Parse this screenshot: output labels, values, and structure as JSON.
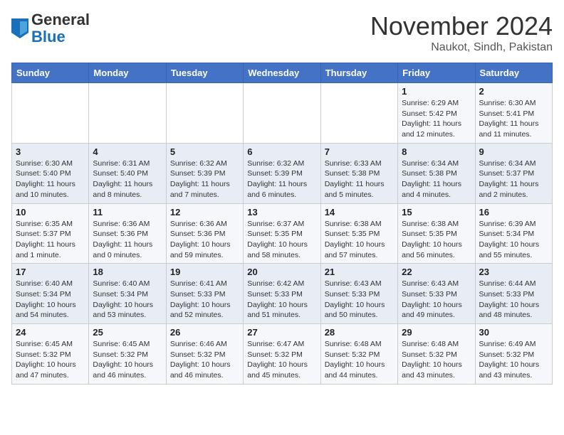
{
  "header": {
    "logo_general": "General",
    "logo_blue": "Blue",
    "month_title": "November 2024",
    "location": "Naukot, Sindh, Pakistan"
  },
  "weekdays": [
    "Sunday",
    "Monday",
    "Tuesday",
    "Wednesday",
    "Thursday",
    "Friday",
    "Saturday"
  ],
  "weeks": [
    [
      {
        "day": "",
        "info": ""
      },
      {
        "day": "",
        "info": ""
      },
      {
        "day": "",
        "info": ""
      },
      {
        "day": "",
        "info": ""
      },
      {
        "day": "",
        "info": ""
      },
      {
        "day": "1",
        "info": "Sunrise: 6:29 AM\nSunset: 5:42 PM\nDaylight: 11 hours and 12 minutes."
      },
      {
        "day": "2",
        "info": "Sunrise: 6:30 AM\nSunset: 5:41 PM\nDaylight: 11 hours and 11 minutes."
      }
    ],
    [
      {
        "day": "3",
        "info": "Sunrise: 6:30 AM\nSunset: 5:40 PM\nDaylight: 11 hours and 10 minutes."
      },
      {
        "day": "4",
        "info": "Sunrise: 6:31 AM\nSunset: 5:40 PM\nDaylight: 11 hours and 8 minutes."
      },
      {
        "day": "5",
        "info": "Sunrise: 6:32 AM\nSunset: 5:39 PM\nDaylight: 11 hours and 7 minutes."
      },
      {
        "day": "6",
        "info": "Sunrise: 6:32 AM\nSunset: 5:39 PM\nDaylight: 11 hours and 6 minutes."
      },
      {
        "day": "7",
        "info": "Sunrise: 6:33 AM\nSunset: 5:38 PM\nDaylight: 11 hours and 5 minutes."
      },
      {
        "day": "8",
        "info": "Sunrise: 6:34 AM\nSunset: 5:38 PM\nDaylight: 11 hours and 4 minutes."
      },
      {
        "day": "9",
        "info": "Sunrise: 6:34 AM\nSunset: 5:37 PM\nDaylight: 11 hours and 2 minutes."
      }
    ],
    [
      {
        "day": "10",
        "info": "Sunrise: 6:35 AM\nSunset: 5:37 PM\nDaylight: 11 hours and 1 minute."
      },
      {
        "day": "11",
        "info": "Sunrise: 6:36 AM\nSunset: 5:36 PM\nDaylight: 11 hours and 0 minutes."
      },
      {
        "day": "12",
        "info": "Sunrise: 6:36 AM\nSunset: 5:36 PM\nDaylight: 10 hours and 59 minutes."
      },
      {
        "day": "13",
        "info": "Sunrise: 6:37 AM\nSunset: 5:35 PM\nDaylight: 10 hours and 58 minutes."
      },
      {
        "day": "14",
        "info": "Sunrise: 6:38 AM\nSunset: 5:35 PM\nDaylight: 10 hours and 57 minutes."
      },
      {
        "day": "15",
        "info": "Sunrise: 6:38 AM\nSunset: 5:35 PM\nDaylight: 10 hours and 56 minutes."
      },
      {
        "day": "16",
        "info": "Sunrise: 6:39 AM\nSunset: 5:34 PM\nDaylight: 10 hours and 55 minutes."
      }
    ],
    [
      {
        "day": "17",
        "info": "Sunrise: 6:40 AM\nSunset: 5:34 PM\nDaylight: 10 hours and 54 minutes."
      },
      {
        "day": "18",
        "info": "Sunrise: 6:40 AM\nSunset: 5:34 PM\nDaylight: 10 hours and 53 minutes."
      },
      {
        "day": "19",
        "info": "Sunrise: 6:41 AM\nSunset: 5:33 PM\nDaylight: 10 hours and 52 minutes."
      },
      {
        "day": "20",
        "info": "Sunrise: 6:42 AM\nSunset: 5:33 PM\nDaylight: 10 hours and 51 minutes."
      },
      {
        "day": "21",
        "info": "Sunrise: 6:43 AM\nSunset: 5:33 PM\nDaylight: 10 hours and 50 minutes."
      },
      {
        "day": "22",
        "info": "Sunrise: 6:43 AM\nSunset: 5:33 PM\nDaylight: 10 hours and 49 minutes."
      },
      {
        "day": "23",
        "info": "Sunrise: 6:44 AM\nSunset: 5:33 PM\nDaylight: 10 hours and 48 minutes."
      }
    ],
    [
      {
        "day": "24",
        "info": "Sunrise: 6:45 AM\nSunset: 5:32 PM\nDaylight: 10 hours and 47 minutes."
      },
      {
        "day": "25",
        "info": "Sunrise: 6:45 AM\nSunset: 5:32 PM\nDaylight: 10 hours and 46 minutes."
      },
      {
        "day": "26",
        "info": "Sunrise: 6:46 AM\nSunset: 5:32 PM\nDaylight: 10 hours and 46 minutes."
      },
      {
        "day": "27",
        "info": "Sunrise: 6:47 AM\nSunset: 5:32 PM\nDaylight: 10 hours and 45 minutes."
      },
      {
        "day": "28",
        "info": "Sunrise: 6:48 AM\nSunset: 5:32 PM\nDaylight: 10 hours and 44 minutes."
      },
      {
        "day": "29",
        "info": "Sunrise: 6:48 AM\nSunset: 5:32 PM\nDaylight: 10 hours and 43 minutes."
      },
      {
        "day": "30",
        "info": "Sunrise: 6:49 AM\nSunset: 5:32 PM\nDaylight: 10 hours and 43 minutes."
      }
    ]
  ]
}
